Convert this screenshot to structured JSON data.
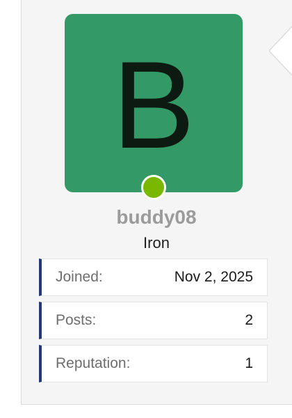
{
  "profile": {
    "avatar_letter": "B",
    "avatar_bg": "#339966",
    "avatar_letter_color": "#0c1a11",
    "online_color": "#7ab800",
    "username": "buddy08",
    "rank": "Iron"
  },
  "stats": [
    {
      "label": "Joined:",
      "value": "Nov 2, 2025"
    },
    {
      "label": "Posts:",
      "value": "2"
    },
    {
      "label": "Reputation:",
      "value": "1"
    }
  ],
  "colors": {
    "stat_accent": "#233a73",
    "panel_bg": "#f5f5f5"
  }
}
